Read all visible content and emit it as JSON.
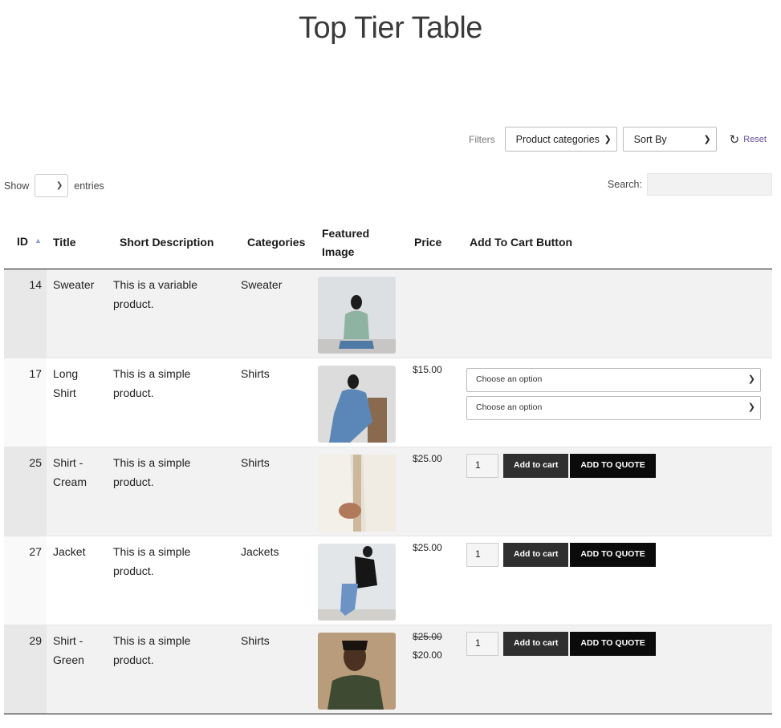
{
  "page": {
    "title": "Top Tier Table"
  },
  "filters": {
    "label": "Filters",
    "categories_select": "Product categories",
    "sort_select": "Sort By",
    "reset_label": "Reset"
  },
  "table_controls": {
    "show_label": "Show",
    "entries_label": "entries",
    "search_label": "Search:"
  },
  "columns": [
    "ID",
    "Title",
    "Short Description",
    "Categories",
    "Featured Image",
    "Price",
    "Add To Cart Button"
  ],
  "rows": [
    {
      "id": "14",
      "title": "Sweater",
      "description": "This is a variable product.",
      "category": "Sweater",
      "price": "",
      "price_old": "",
      "cart": "none"
    },
    {
      "id": "17",
      "title": "Long Shirt",
      "description": "This is a simple product.",
      "category": "Shirts",
      "price": "$15.00",
      "price_old": "",
      "cart": "options",
      "option_1": "Choose an option",
      "option_2": "Choose an option"
    },
    {
      "id": "25",
      "title": "Shirt - Cream",
      "description": "This is a simple product.",
      "category": "Shirts",
      "price": "$25.00",
      "price_old": "",
      "cart": "buttons",
      "qty": "1",
      "add_to_cart": "Add to cart",
      "add_to_quote": "ADD TO QUOTE"
    },
    {
      "id": "27",
      "title": "Jacket",
      "description": "This is a simple product.",
      "category": "Jackets",
      "price": "$25.00",
      "price_old": "",
      "cart": "buttons",
      "qty": "1",
      "add_to_cart": "Add to cart",
      "add_to_quote": "ADD TO QUOTE"
    },
    {
      "id": "29",
      "title": "Shirt - Green",
      "description": "This is a simple product.",
      "category": "Shirts",
      "price": "$20.00",
      "price_old": "$25.00",
      "cart": "buttons",
      "qty": "1",
      "add_to_cart": "Add to cart",
      "add_to_quote": "ADD TO QUOTE"
    }
  ],
  "icons": {
    "sort": "sort-ascending-icon",
    "reset": "reset-icon",
    "dropdown": "chevron-down-icon"
  },
  "colors": {
    "accent_link": "#6b4f9e",
    "button_dark": "#2f2f2f",
    "button_quote": "#0b0b0b",
    "sort_arrow": "#8a9be0"
  }
}
